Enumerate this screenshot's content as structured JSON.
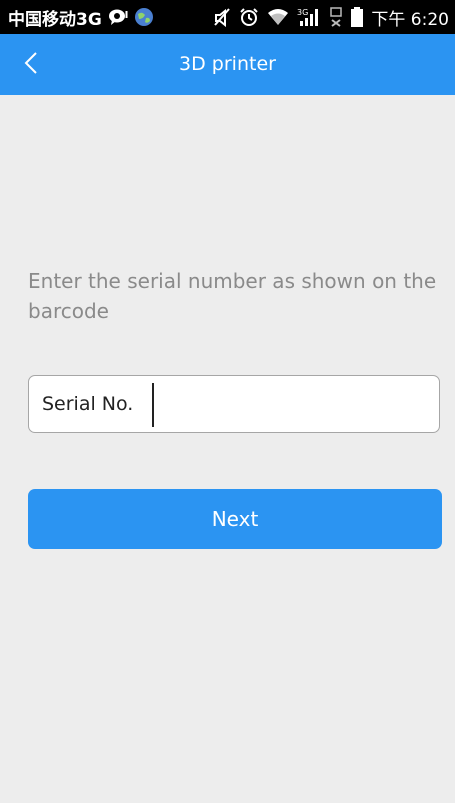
{
  "status_bar": {
    "carrier": "中国移动3G",
    "time": "下午 6:20",
    "network_badge": "3G",
    "icons": [
      "chat-bubble-icon",
      "globe-app-icon",
      "mute-icon",
      "alarm-icon",
      "wifi-icon",
      "signal-icon",
      "no-sim-icon",
      "battery-icon"
    ]
  },
  "header": {
    "title": "3D printer",
    "back_icon": "chevron-left-icon"
  },
  "main": {
    "instruction": "Enter the serial number as shown on the barcode",
    "serial_field": {
      "label": "Serial No.",
      "value": "",
      "placeholder": ""
    },
    "next_label": "Next"
  },
  "colors": {
    "accent": "#2b94f2",
    "background": "#ededed",
    "status_bar": "#000000"
  }
}
